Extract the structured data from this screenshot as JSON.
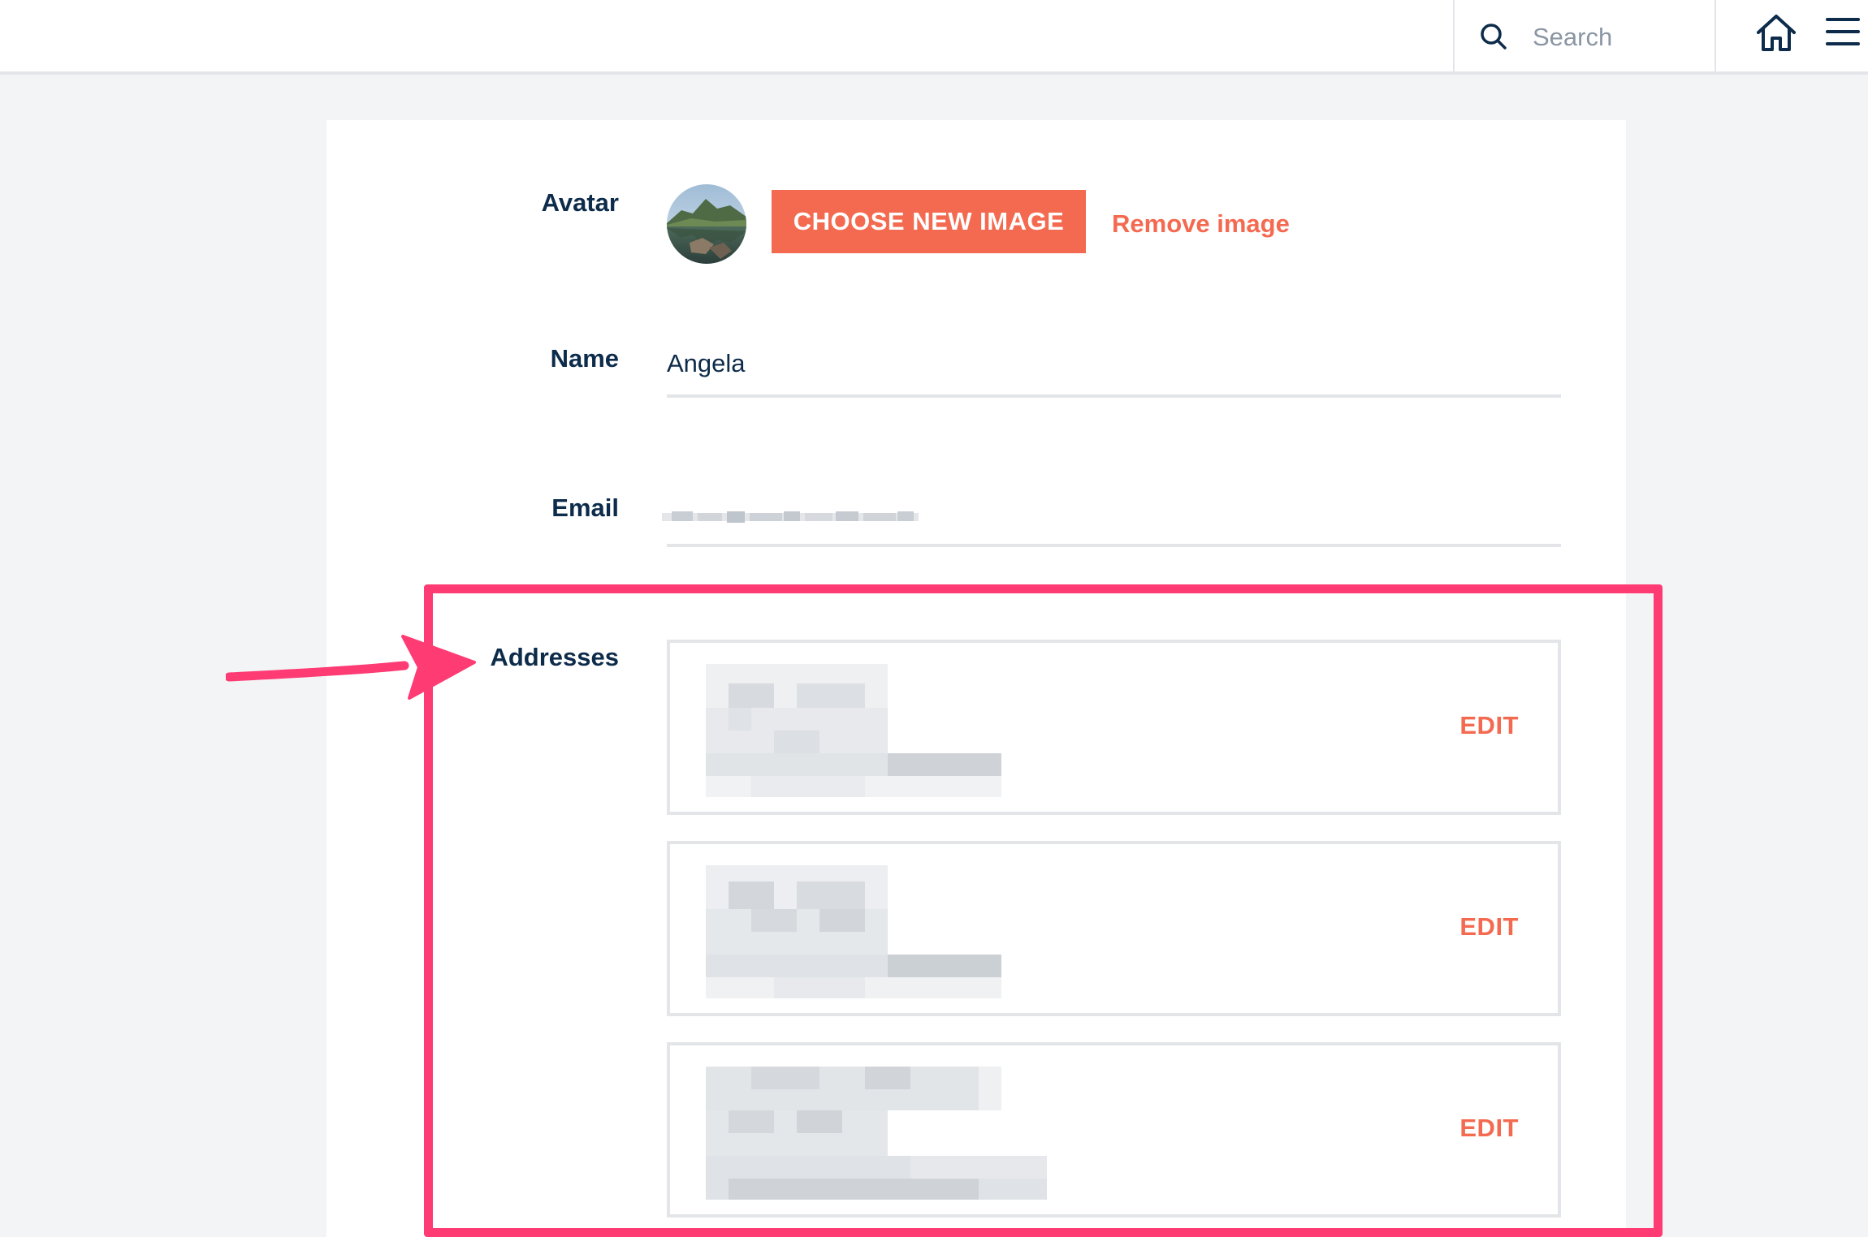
{
  "header": {
    "search_placeholder": "Search",
    "icons": [
      "search-icon",
      "home-icon",
      "menu-icon"
    ]
  },
  "profile": {
    "avatar": {
      "label": "Avatar",
      "choose_button": "CHOOSE NEW IMAGE",
      "remove_link": "Remove image"
    },
    "name": {
      "label": "Name",
      "value": "Angela"
    },
    "email": {
      "label": "Email"
    },
    "addresses": {
      "label": "Addresses",
      "items": [
        {
          "edit_label": "EDIT"
        },
        {
          "edit_label": "EDIT"
        },
        {
          "edit_label": "EDIT"
        }
      ]
    }
  },
  "colors": {
    "accent": "#f46a50",
    "text": "#0d2b4a",
    "annotation": "#ff3b74",
    "border": "#e3e5e8",
    "background": "#f3f4f6"
  }
}
